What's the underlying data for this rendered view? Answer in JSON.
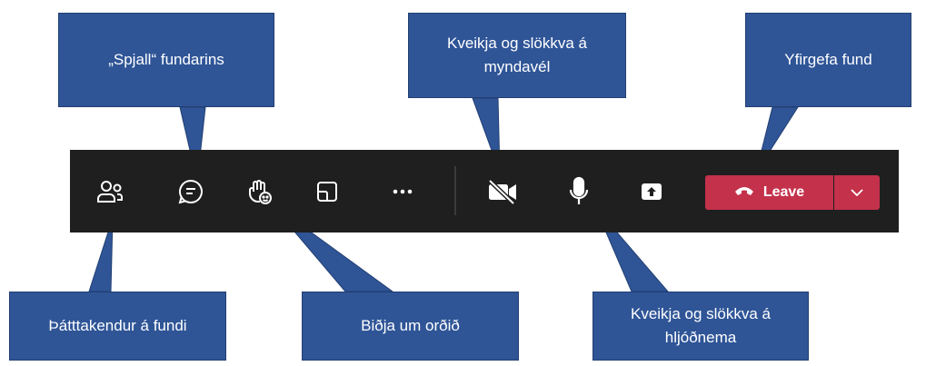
{
  "toolbar": {
    "leave_label": "Leave",
    "colors": {
      "background": "#1f1f1f",
      "leave": "#c4314b",
      "icon": "#ffffff"
    },
    "icons": [
      "participants-icon",
      "chat-icon",
      "raise-hand-icon",
      "rooms-icon",
      "more-icon",
      "camera-off-icon",
      "mic-icon",
      "share-icon",
      "phone-hangup-icon",
      "chevron-down-icon"
    ]
  },
  "callouts": {
    "chat": "„Spjall“ fundarins",
    "camera": "Kveikja og slökkva á myndavél",
    "leave": "Yfirgefa fund",
    "participants": "Þátttakendur á fundi",
    "raise_hand": "Biðja um orðið",
    "mic": "Kveikja og slökkva á hljóðnema",
    "color": "#2f5597"
  }
}
